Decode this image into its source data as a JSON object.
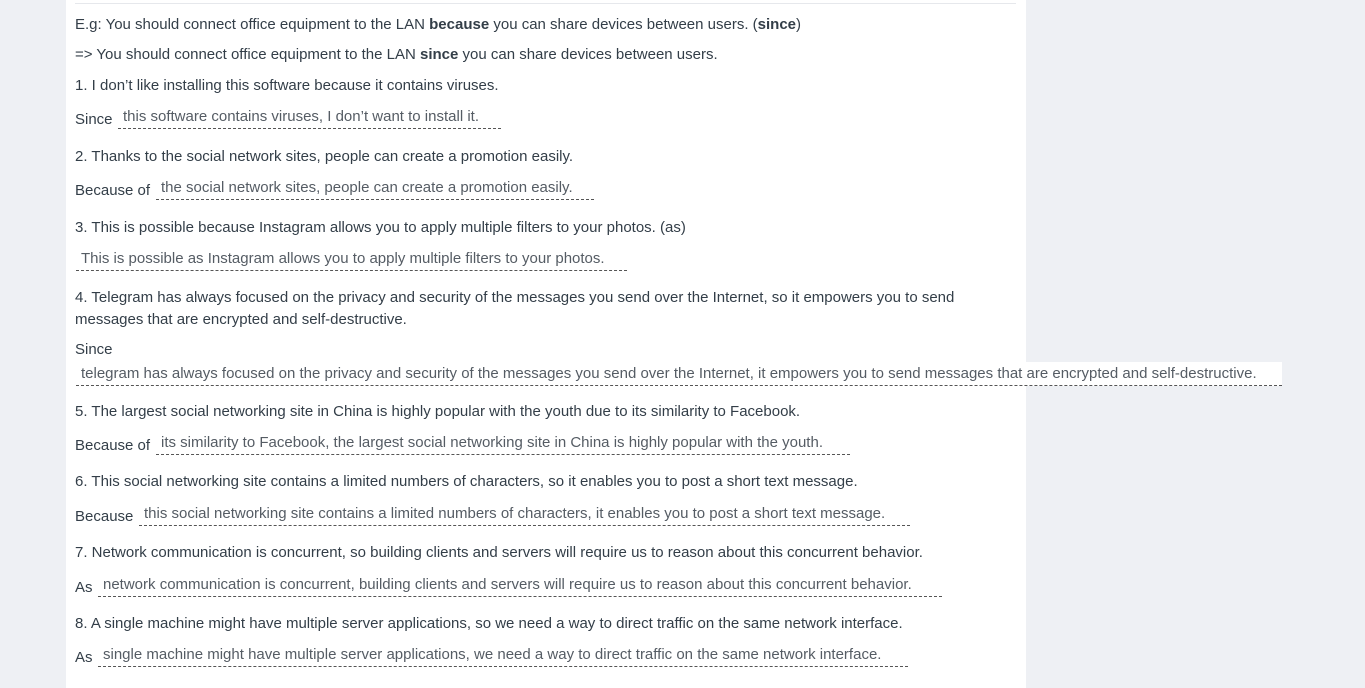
{
  "example": {
    "prompt_pre": "E.g: You should connect office equipment to the LAN ",
    "prompt_bold": "because",
    "prompt_mid": " you can share devices between users. (",
    "prompt_hint": "since",
    "prompt_end": ")",
    "answer_pre": "=> You should connect office equipment to the LAN ",
    "answer_bold": "since",
    "answer_post": " you can share devices between users."
  },
  "questions": [
    {
      "prompt": "1. I don’t like installing this software because it contains viruses.",
      "prefix": "Since",
      "answer": "this software contains viruses, I don’t want to install it."
    },
    {
      "prompt": "2. Thanks to the social network sites, people can create a promotion easily.",
      "prefix": "Because of",
      "answer": "the social network sites, people can create a promotion easily."
    },
    {
      "prompt": "3. This is possible because Instagram allows you to apply multiple filters to your photos. (as)",
      "prefix": "",
      "answer": "This is possible as Instagram allows you to apply multiple filters to your photos."
    },
    {
      "prompt": "4. Telegram has always focused on the privacy and security of the messages you send over the Internet, so it empowers you to send messages that are encrypted and self-destructive.",
      "prefix": "Since",
      "answer": "telegram has always focused on the privacy and security of the messages you send over the Internet, it empowers you to send messages that are encrypted and self-destructive."
    },
    {
      "prompt": "5. The largest social networking site in China is highly popular with the youth due to its similarity to Facebook.",
      "prefix": "Because of",
      "answer": "its similarity to Facebook, the largest social networking site in China is highly popular with the youth."
    },
    {
      "prompt": "6. This social networking site contains a limited numbers of characters, so it enables you to post a short text message.",
      "prefix": "Because",
      "answer": "this social networking site contains a limited numbers of characters, it enables you to post a short text message."
    },
    {
      "prompt": "7. Network communication is concurrent, so building clients and servers will require us to reason about this concurrent behavior.",
      "prefix": "As",
      "answer": "network communication is concurrent, building clients and servers will require us to reason about this concurrent behavior."
    },
    {
      "prompt": "8. A single machine might have multiple server applications, so we need a way to direct traffic on the same network interface.",
      "prefix": "As",
      "answer": "single machine might have multiple server applications, we need a way to direct traffic on the same network interface."
    }
  ]
}
